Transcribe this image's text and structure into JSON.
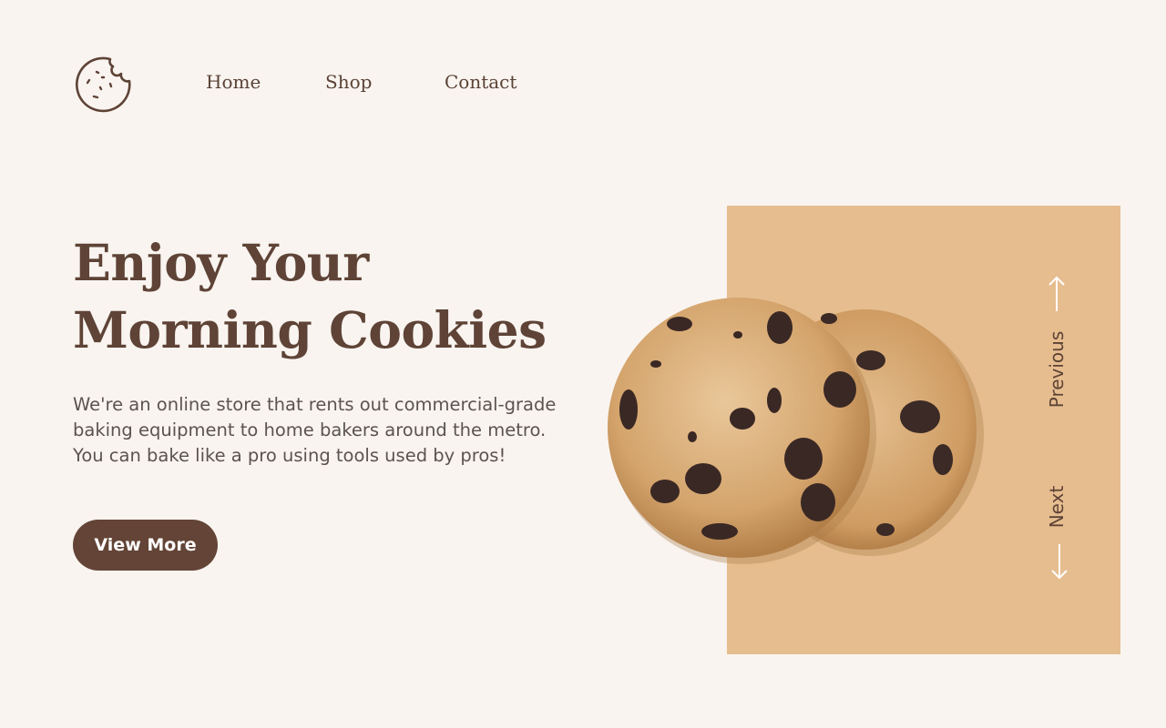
{
  "header": {
    "logo_icon": "cookie-icon",
    "nav": [
      {
        "label": "Home"
      },
      {
        "label": "Shop"
      },
      {
        "label": "Contact"
      }
    ]
  },
  "hero": {
    "title_lines": [
      "Enjoy Your",
      "Morning Cookies"
    ],
    "description_lines": [
      "We're an online store that rents out commercial-grade",
      "baking equipment to home bakers around the metro.",
      "You can bake like a pro using tools used by pros!"
    ],
    "cta_label": "View More"
  },
  "carousel": {
    "previous_label": "Previous",
    "next_label": "Next",
    "previous_icon": "arrow-up-icon",
    "next_icon": "arrow-down-icon"
  },
  "colors": {
    "background": "#f9f4f0",
    "brand_brown": "#5e4336",
    "panel": "#e6bd8f",
    "body_text": "#5b5350"
  }
}
